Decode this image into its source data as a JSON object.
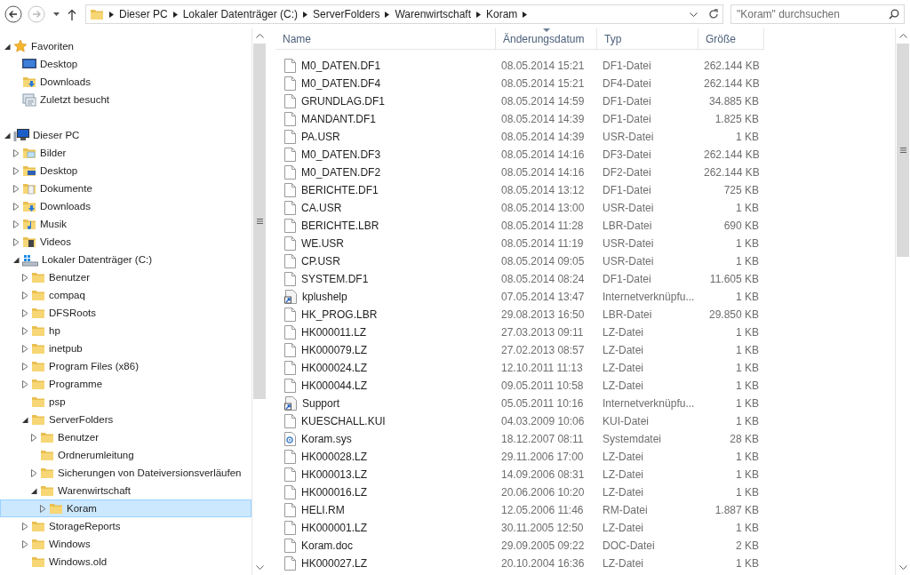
{
  "toolbar": {
    "back_enabled": true,
    "forward_enabled": false
  },
  "address": {
    "crumbs": [
      "Dieser PC",
      "Lokaler Datenträger (C:)",
      "ServerFolders",
      "Warenwirtschaft",
      "Koram"
    ]
  },
  "search": {
    "placeholder": "\"Koram\" durchsuchen"
  },
  "navigation": [
    {
      "label": "Favoriten",
      "kind": "star",
      "expanded": true,
      "selected": false,
      "children": [
        {
          "label": "Desktop",
          "kind": "desktop",
          "selected": false
        },
        {
          "label": "Downloads",
          "kind": "downloads",
          "selected": false
        },
        {
          "label": "Zuletzt besucht",
          "kind": "recent",
          "selected": false
        }
      ]
    },
    {
      "label": "Dieser PC",
      "kind": "pc",
      "expanded": true,
      "selected": false,
      "children": [
        {
          "label": "Bilder",
          "kind": "pictures",
          "expanded": false,
          "selected": false
        },
        {
          "label": "Desktop",
          "kind": "desktop-folder",
          "expanded": false,
          "selected": false
        },
        {
          "label": "Dokumente",
          "kind": "documents",
          "expanded": false,
          "selected": false
        },
        {
          "label": "Downloads",
          "kind": "downloads",
          "expanded": false,
          "selected": false
        },
        {
          "label": "Musik",
          "kind": "music",
          "expanded": false,
          "selected": false
        },
        {
          "label": "Videos",
          "kind": "videos",
          "expanded": false,
          "selected": false
        },
        {
          "label": "Lokaler Datenträger (C:)",
          "kind": "drive",
          "expanded": true,
          "selected": false,
          "children": [
            {
              "label": "Benutzer",
              "kind": "folder",
              "expanded": false,
              "selected": false
            },
            {
              "label": "compaq",
              "kind": "folder",
              "expanded": false,
              "selected": false
            },
            {
              "label": "DFSRoots",
              "kind": "folder",
              "expanded": false,
              "selected": false
            },
            {
              "label": "hp",
              "kind": "folder",
              "expanded": false,
              "selected": false
            },
            {
              "label": "inetpub",
              "kind": "folder",
              "expanded": false,
              "selected": false
            },
            {
              "label": "Program Files (x86)",
              "kind": "folder",
              "expanded": false,
              "selected": false
            },
            {
              "label": "Programme",
              "kind": "folder",
              "expanded": false,
              "selected": false
            },
            {
              "label": "psp",
              "kind": "folder",
              "selected": false
            },
            {
              "label": "ServerFolders",
              "kind": "folder",
              "expanded": true,
              "selected": false,
              "children": [
                {
                  "label": "Benutzer",
                  "kind": "folder",
                  "expanded": false,
                  "selected": false
                },
                {
                  "label": "Ordnerumleitung",
                  "kind": "folder",
                  "selected": false
                },
                {
                  "label": "Sicherungen von Dateiversionsverläufen",
                  "kind": "folder",
                  "expanded": false,
                  "selected": false
                },
                {
                  "label": "Warenwirtschaft",
                  "kind": "folder",
                  "expanded": true,
                  "selected": false,
                  "children": [
                    {
                      "label": "Koram",
                      "kind": "folder",
                      "expanded": false,
                      "selected": true
                    }
                  ]
                }
              ]
            },
            {
              "label": "StorageReports",
              "kind": "folder",
              "expanded": false,
              "selected": false
            },
            {
              "label": "Windows",
              "kind": "folder",
              "expanded": false,
              "selected": false
            },
            {
              "label": "Windows.old",
              "kind": "folder",
              "selected": false
            }
          ]
        }
      ]
    }
  ],
  "columns": [
    {
      "label": "Name",
      "sorted": false
    },
    {
      "label": "Änderungsdatum",
      "sorted": true
    },
    {
      "label": "Typ",
      "sorted": false
    },
    {
      "label": "Größe",
      "sorted": false
    }
  ],
  "files": [
    {
      "name": "M0_DATEN.DF1",
      "date": "08.05.2014 15:21",
      "type": "DF1-Datei",
      "size": "262.144 KB",
      "kind": "file"
    },
    {
      "name": "M0_DATEN.DF4",
      "date": "08.05.2014 15:21",
      "type": "DF4-Datei",
      "size": "262.144 KB",
      "kind": "file"
    },
    {
      "name": "GRUNDLAG.DF1",
      "date": "08.05.2014 14:59",
      "type": "DF1-Datei",
      "size": "34.885 KB",
      "kind": "file"
    },
    {
      "name": "MANDANT.DF1",
      "date": "08.05.2014 14:39",
      "type": "DF1-Datei",
      "size": "1.825 KB",
      "kind": "file"
    },
    {
      "name": "PA.USR",
      "date": "08.05.2014 14:39",
      "type": "USR-Datei",
      "size": "1 KB",
      "kind": "file"
    },
    {
      "name": "M0_DATEN.DF3",
      "date": "08.05.2014 14:16",
      "type": "DF3-Datei",
      "size": "262.144 KB",
      "kind": "file"
    },
    {
      "name": "M0_DATEN.DF2",
      "date": "08.05.2014 14:16",
      "type": "DF2-Datei",
      "size": "262.144 KB",
      "kind": "file"
    },
    {
      "name": "BERICHTE.DF1",
      "date": "08.05.2014 13:12",
      "type": "DF1-Datei",
      "size": "725 KB",
      "kind": "file"
    },
    {
      "name": "CA.USR",
      "date": "08.05.2014 13:00",
      "type": "USR-Datei",
      "size": "1 KB",
      "kind": "file"
    },
    {
      "name": "BERICHTE.LBR",
      "date": "08.05.2014 11:28",
      "type": "LBR-Datei",
      "size": "690 KB",
      "kind": "file"
    },
    {
      "name": "WE.USR",
      "date": "08.05.2014 11:19",
      "type": "USR-Datei",
      "size": "1 KB",
      "kind": "file"
    },
    {
      "name": "CP.USR",
      "date": "08.05.2014 09:05",
      "type": "USR-Datei",
      "size": "1 KB",
      "kind": "file"
    },
    {
      "name": "SYSTEM.DF1",
      "date": "08.05.2014 08:24",
      "type": "DF1-Datei",
      "size": "11.605 KB",
      "kind": "file"
    },
    {
      "name": "kplushelp",
      "date": "07.05.2014 13:47",
      "type": "Internetverknüpfu...",
      "size": "1 KB",
      "kind": "shortcut"
    },
    {
      "name": "HK_PROG.LBR",
      "date": "29.08.2013 16:50",
      "type": "LBR-Datei",
      "size": "29.850 KB",
      "kind": "file"
    },
    {
      "name": "HK000011.LZ",
      "date": "27.03.2013 09:11",
      "type": "LZ-Datei",
      "size": "1 KB",
      "kind": "file"
    },
    {
      "name": "HK000079.LZ",
      "date": "27.02.2013 08:57",
      "type": "LZ-Datei",
      "size": "1 KB",
      "kind": "file"
    },
    {
      "name": "HK000024.LZ",
      "date": "12.10.2011 11:13",
      "type": "LZ-Datei",
      "size": "1 KB",
      "kind": "file"
    },
    {
      "name": "HK000044.LZ",
      "date": "09.05.2011 10:58",
      "type": "LZ-Datei",
      "size": "1 KB",
      "kind": "file"
    },
    {
      "name": "Support",
      "date": "05.05.2011 10:16",
      "type": "Internetverknüpfu...",
      "size": "1 KB",
      "kind": "shortcut"
    },
    {
      "name": "KUESCHALL.KUI",
      "date": "04.03.2009 10:06",
      "type": "KUI-Datei",
      "size": "1 KB",
      "kind": "file"
    },
    {
      "name": "Koram.sys",
      "date": "18.12.2007 08:11",
      "type": "Systemdatei",
      "size": "28 KB",
      "kind": "system"
    },
    {
      "name": "HK000028.LZ",
      "date": "29.11.2006 17:00",
      "type": "LZ-Datei",
      "size": "1 KB",
      "kind": "file"
    },
    {
      "name": "HK000013.LZ",
      "date": "14.09.2006 08:31",
      "type": "LZ-Datei",
      "size": "1 KB",
      "kind": "file"
    },
    {
      "name": "HK000016.LZ",
      "date": "20.06.2006 10:20",
      "type": "LZ-Datei",
      "size": "1 KB",
      "kind": "file"
    },
    {
      "name": "HELI.RM",
      "date": "12.05.2006 11:46",
      "type": "RM-Datei",
      "size": "1.887 KB",
      "kind": "file"
    },
    {
      "name": "HK000001.LZ",
      "date": "30.11.2005 12:50",
      "type": "LZ-Datei",
      "size": "1 KB",
      "kind": "file"
    },
    {
      "name": "Koram.doc",
      "date": "29.09.2005 09:22",
      "type": "DOC-Datei",
      "size": "2 KB",
      "kind": "file"
    },
    {
      "name": "HK000027.LZ",
      "date": "20.10.2004 16:36",
      "type": "LZ-Datei",
      "size": "1 KB",
      "kind": "file"
    }
  ]
}
